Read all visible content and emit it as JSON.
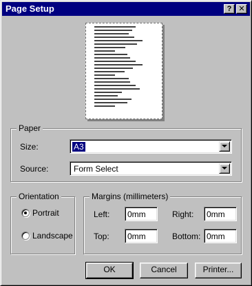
{
  "window": {
    "title": "Page Setup",
    "help_label": "?",
    "close_label": "✕"
  },
  "paper": {
    "legend": "Paper",
    "size_label": "Size:",
    "size_value": "A3",
    "source_label": "Source:",
    "source_value": "Form Select"
  },
  "orientation": {
    "legend": "Orientation",
    "options": [
      {
        "label": "Portrait",
        "selected": true
      },
      {
        "label": "Landscape",
        "selected": false
      }
    ]
  },
  "margins": {
    "legend": "Margins (millimeters)",
    "left_label": "Left:",
    "left_value": "0mm",
    "right_label": "Right:",
    "right_value": "0mm",
    "top_label": "Top:",
    "top_value": "0mm",
    "bottom_label": "Bottom:",
    "bottom_value": "0mm"
  },
  "buttons": {
    "ok": "OK",
    "cancel": "Cancel",
    "printer": "Printer..."
  },
  "colors": {
    "titlebar": "#000080",
    "face": "#c0c0c0"
  }
}
